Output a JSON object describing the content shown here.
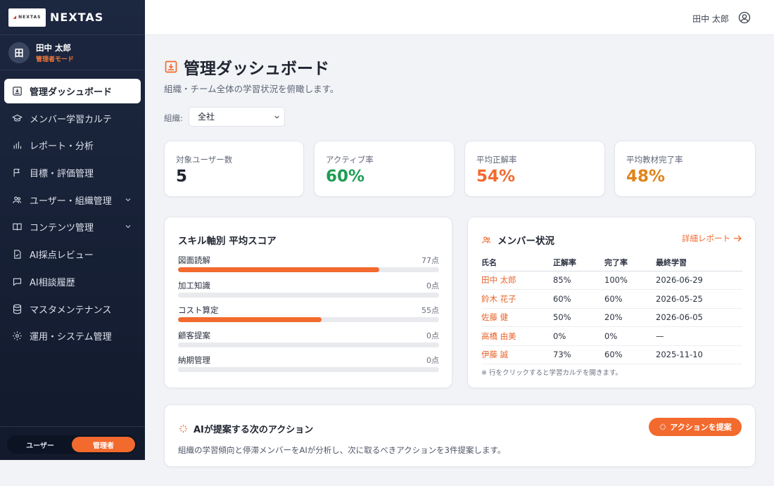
{
  "brand": {
    "logo_text": "NEXTAS",
    "name": "NEXTAS"
  },
  "user": {
    "initial": "田",
    "name": "田中 太郎",
    "mode": "管理者モード"
  },
  "nav": [
    {
      "label": "管理ダッシュボード",
      "icon": "dashboard-icon",
      "active": true
    },
    {
      "label": "メンバー学習カルテ",
      "icon": "graduation-cap-icon"
    },
    {
      "label": "レポート・分析",
      "icon": "bar-chart-icon"
    },
    {
      "label": "目標・評価管理",
      "icon": "flag-icon"
    },
    {
      "label": "ユーザー・組織管理",
      "icon": "users-icon",
      "expandable": true
    },
    {
      "label": "コンテンツ管理",
      "icon": "book-icon",
      "expandable": true
    },
    {
      "label": "AI採点レビュー",
      "icon": "file-check-icon"
    },
    {
      "label": "AI相談履歴",
      "icon": "chat-icon"
    },
    {
      "label": "マスタメンテナンス",
      "icon": "database-icon"
    },
    {
      "label": "運用・システム管理",
      "icon": "gear-icon"
    }
  ],
  "role_toggle": {
    "user_label": "ユーザー",
    "admin_label": "管理者",
    "active": "admin"
  },
  "header": {
    "user_name": "田中 太郎"
  },
  "page": {
    "title": "管理ダッシュボード",
    "subtitle": "組織・チーム全体の学習状況を俯瞰します。",
    "org_label": "組織:",
    "org_value": "全社"
  },
  "kpis": [
    {
      "label": "対象ユーザー数",
      "value": "5",
      "color": "#1f2430"
    },
    {
      "label": "アクティブ率",
      "value": "60%",
      "color": "#1f9d55"
    },
    {
      "label": "平均正解率",
      "value": "54%",
      "color": "#f26a2e"
    },
    {
      "label": "平均教材完了率",
      "value": "48%",
      "color": "#e0841a"
    }
  ],
  "skills": {
    "title": "スキル軸別 平均スコア",
    "items": [
      {
        "name": "図面読解",
        "score": 77,
        "label": "77点"
      },
      {
        "name": "加工知識",
        "score": 0,
        "label": "0点"
      },
      {
        "name": "コスト算定",
        "score": 55,
        "label": "55点"
      },
      {
        "name": "顧客提案",
        "score": 0,
        "label": "0点"
      },
      {
        "name": "納期管理",
        "score": 0,
        "label": "0点"
      }
    ]
  },
  "members": {
    "title": "メンバー状況",
    "detail_link": "詳細レポート",
    "columns": [
      "氏名",
      "正解率",
      "完了率",
      "最終学習"
    ],
    "rows": [
      [
        "田中 太郎",
        "85%",
        "100%",
        "2026-06-29"
      ],
      [
        "鈴木 花子",
        "60%",
        "60%",
        "2026-05-25"
      ],
      [
        "佐藤 健",
        "50%",
        "20%",
        "2026-06-05"
      ],
      [
        "高橋 由美",
        "0%",
        "0%",
        "—"
      ],
      [
        "伊藤 誠",
        "73%",
        "60%",
        "2025-11-10"
      ]
    ],
    "note": "※ 行をクリックすると学習カルテを開きます。"
  },
  "ai": {
    "title": "AIが提案する次のアクション",
    "button": "アクションを提案",
    "description": "組織の学習傾向と停滞メンバーをAIが分析し、次に取るべきアクションを3件提案します。"
  },
  "colors": {
    "accent": "#f26a2e",
    "sidebar": "#1c2740",
    "success": "#1f9d55"
  }
}
